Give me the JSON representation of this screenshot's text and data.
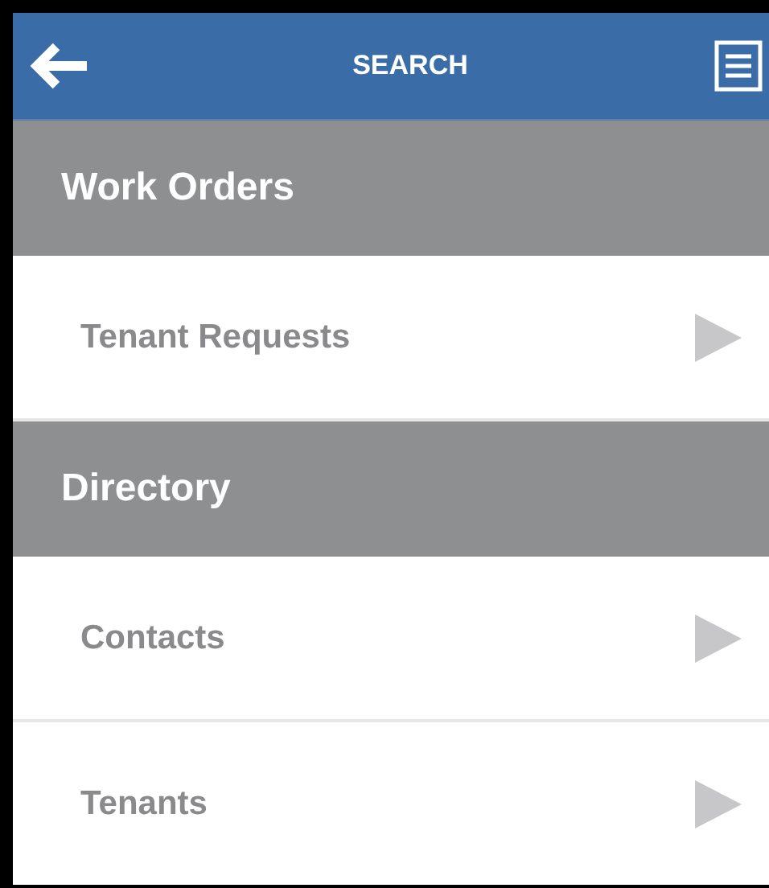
{
  "header": {
    "title": "SEARCH"
  },
  "sections": [
    {
      "title": "Work Orders",
      "items": [
        {
          "label": "Tenant Requests"
        }
      ]
    },
    {
      "title": "Directory",
      "items": [
        {
          "label": "Contacts"
        },
        {
          "label": "Tenants"
        }
      ]
    }
  ]
}
